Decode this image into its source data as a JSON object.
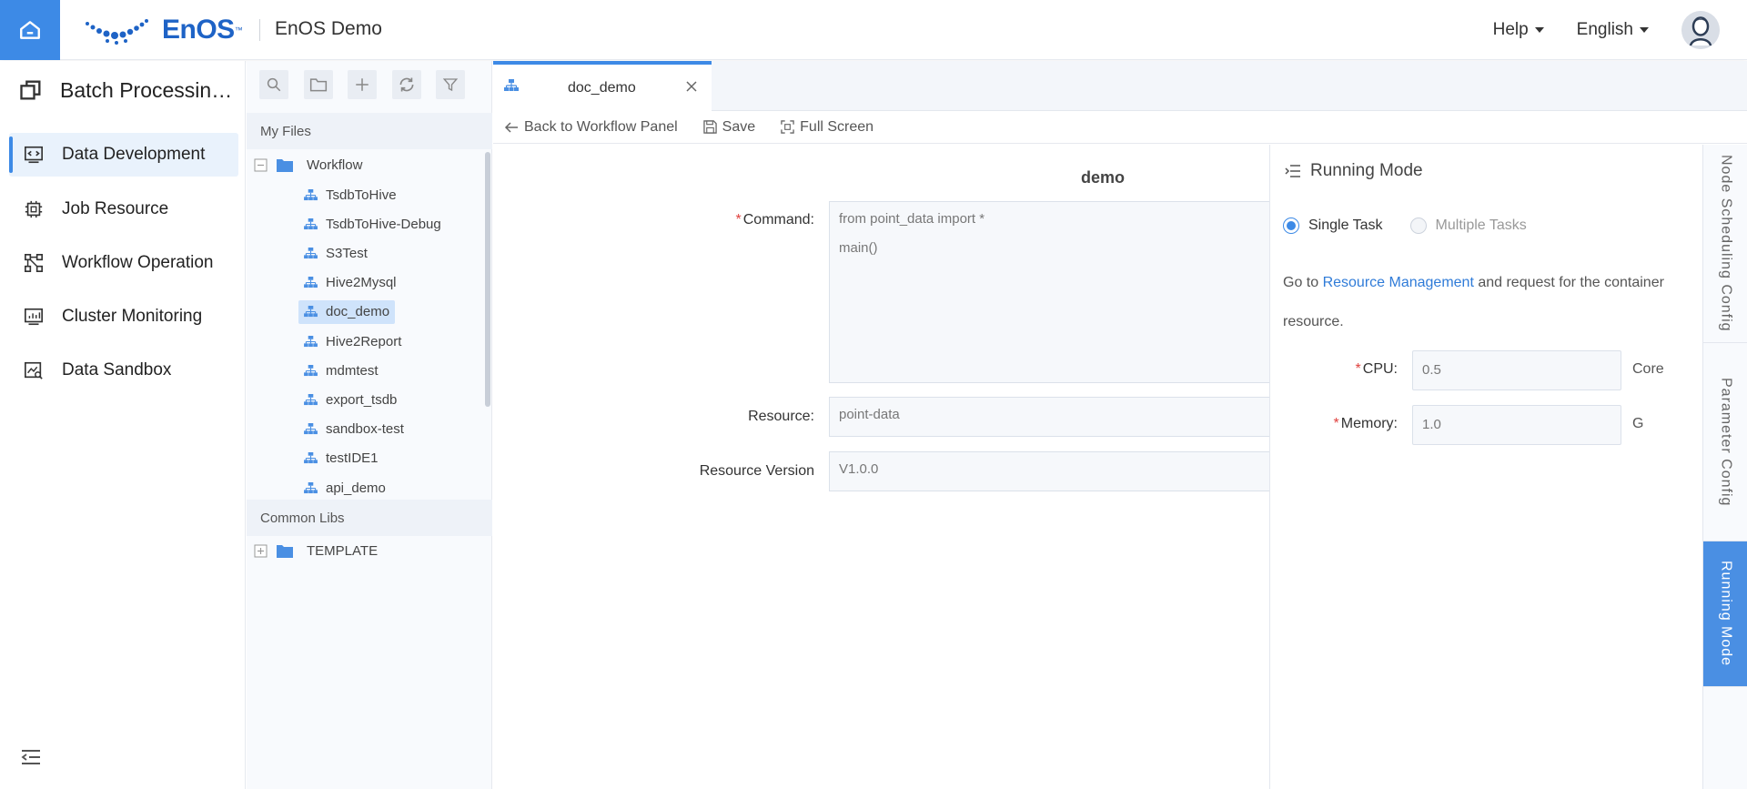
{
  "header": {
    "logo_text": "EnOS",
    "logo_tm": "™",
    "app_title": "EnOS Demo",
    "help_label": "Help",
    "language_label": "English"
  },
  "leftnav": {
    "module_title": "Batch Processing...",
    "items": [
      {
        "label": "Data Development",
        "icon": "code-screen-icon",
        "active": true
      },
      {
        "label": "Job Resource",
        "icon": "chip-icon",
        "active": false
      },
      {
        "label": "Workflow Operation",
        "icon": "workflow-icon",
        "active": false
      },
      {
        "label": "Cluster Monitoring",
        "icon": "monitor-icon",
        "active": false
      },
      {
        "label": "Data Sandbox",
        "icon": "sandbox-icon",
        "active": false
      }
    ]
  },
  "filepanel": {
    "my_files_label": "My Files",
    "workflow_folder": "Workflow",
    "files": [
      "TsdbToHive",
      "TsdbToHive-Debug",
      "S3Test",
      "Hive2Mysql",
      "doc_demo",
      "Hive2Report",
      "mdmtest",
      "export_tsdb",
      "sandbox-test",
      "testIDE1",
      "api_demo"
    ],
    "selected_file": "doc_demo",
    "common_libs_label": "Common Libs",
    "template_folder": "TEMPLATE"
  },
  "tab": {
    "name": "doc_demo"
  },
  "toolbar": {
    "back_label": "Back to Workflow Panel",
    "save_label": "Save",
    "fullscreen_label": "Full Screen"
  },
  "form": {
    "title": "demo",
    "command_label": "Command:",
    "command_lines": [
      "from point_data import *",
      "main()"
    ],
    "resource_label": "Resource:",
    "resource_value": "point-data",
    "version_label": "Resource Version",
    "version_value": "V1.0.0"
  },
  "running_mode": {
    "title": "Running Mode",
    "single_task": "Single Task",
    "multiple_tasks": "Multiple Tasks",
    "note_prefix": "Go to ",
    "note_link": "Resource Management",
    "note_suffix": " and request for the container resource.",
    "cpu_label": "CPU:",
    "cpu_value": "0.5",
    "cpu_unit": "Core",
    "memory_label": "Memory:",
    "memory_value": "1.0",
    "memory_unit": "G"
  },
  "vtabs": [
    "Node Scheduling Config",
    "Parameter Config",
    "Running Mode"
  ],
  "colors": {
    "accent": "#3d8ae6",
    "link": "#2f7bd8",
    "required": "#e0413e"
  }
}
